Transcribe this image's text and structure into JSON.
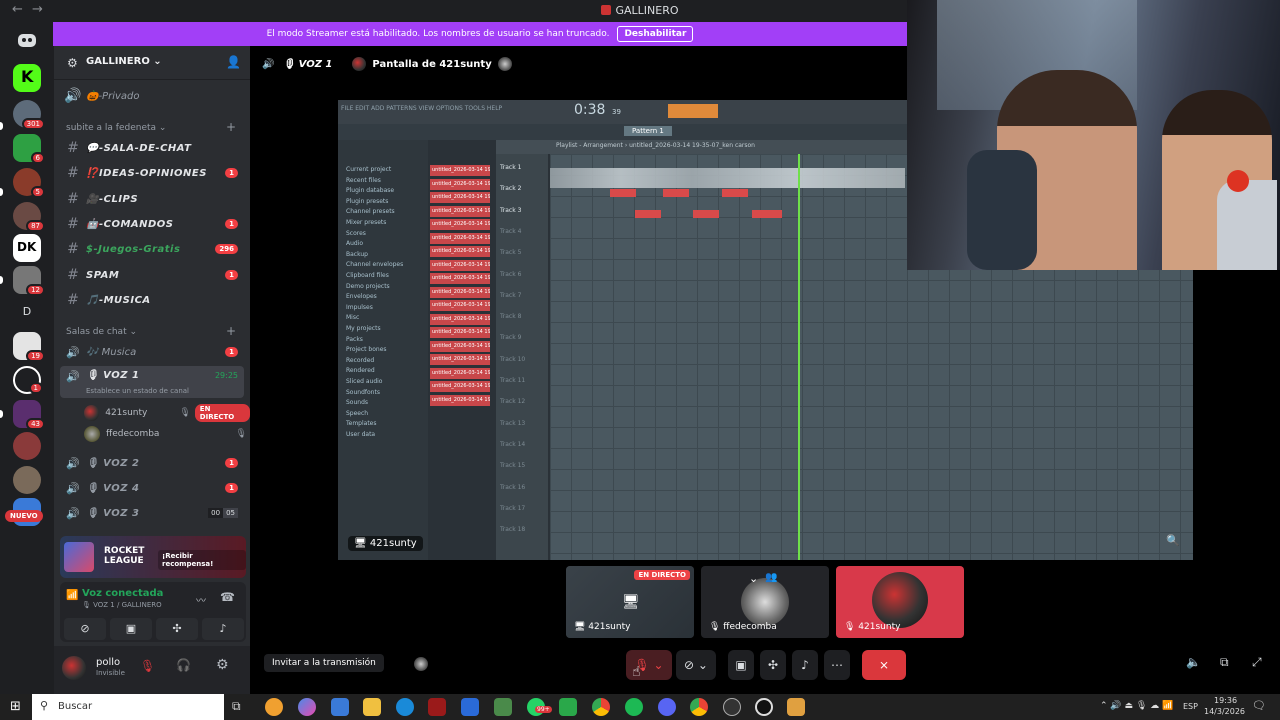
{
  "window": {
    "title": "GALLINERO",
    "back": "←",
    "forward": "→"
  },
  "guild_rail": {
    "badges": [
      "301",
      "6",
      "5",
      "87",
      "12",
      "D",
      "19",
      "1",
      "43"
    ],
    "new_label": "NUEVO"
  },
  "server": {
    "name": "GALLINERO ⌄",
    "private_channel": "🎃-Privado",
    "category1": "subite a la fedeneta",
    "text_channels": [
      {
        "name": "💬-SALA-DE-CHAT",
        "badge": ""
      },
      {
        "name": "⁉️IDEAS-OPINIONES",
        "badge": "1"
      },
      {
        "name": "🎥-CLIPS",
        "badge": ""
      },
      {
        "name": "🤖-COMANDOS",
        "badge": "1"
      },
      {
        "name": "$-Juegos-Gratis",
        "badge": "296"
      },
      {
        "name": "SPAM",
        "badge": "1"
      },
      {
        "name": "🎵-MUSICA",
        "badge": ""
      }
    ],
    "category2": "Salas de chat",
    "voice_channels": {
      "musica": {
        "name": "🎶 Musica",
        "badge": "1"
      },
      "voz1": {
        "name": "🎙 VOZ 1",
        "time": "29:25",
        "status": "Establece un estado de canal"
      },
      "voz1_users": [
        {
          "name": "421sunty",
          "live": "EN DIRECTO"
        },
        {
          "name": "ffedecomba"
        }
      ],
      "voz2": {
        "name": "🎙 VOZ 2",
        "badge": "1"
      },
      "voz4": {
        "name": "🎙 VOZ 4",
        "badge": "1"
      },
      "voz3": {
        "name": "🎙 VOZ 3",
        "count1": "00",
        "count2": "05"
      }
    }
  },
  "promo": {
    "game": "ROCKET LEAGUE",
    "cta": "¡Recibir recompensa!"
  },
  "voice_status": {
    "title": "Voz conectada",
    "subtitle": "🎙 VOZ 1 / GALLINERO"
  },
  "user": {
    "name": "pollo",
    "status": "Invisible"
  },
  "banner": {
    "text": "El modo Streamer está habilitado. Los nombres de usuario se han truncado.",
    "button": "Deshabilitar"
  },
  "voice_header": {
    "channel": "🎙 VOZ 1",
    "screen": "Pantalla de 421sunty"
  },
  "stage": {
    "streamer_label": "421sunty",
    "fl": {
      "menu": "FILE EDIT ADD PATTERNS VIEW OPTIONS TOOLS HELP",
      "time": "0:38",
      "time_sub": "39",
      "pattern": "Pattern 1",
      "playlist_title": "Playlist - Arrangement › untitled_2026-03-14 19-35-07_ken carson",
      "browser_items": [
        "Current project",
        "Recent files",
        "Plugin database",
        "Plugin presets",
        "Channel presets",
        "Mixer presets",
        "Scores",
        "Audio",
        "Backup",
        "Channel envelopes",
        "Clipboard files",
        "Demo projects",
        "Envelopes",
        "Impulses",
        "Misc",
        "My projects",
        "Packs",
        "Project bones",
        "Recorded",
        "Rendered",
        "Sliced audio",
        "Soundfonts",
        "Sounds",
        "Speech",
        "Templates",
        "User data"
      ],
      "clip_label": "untitled_2026-03-14 19..",
      "track_labels": [
        "Track 1",
        "Track 2",
        "Track 3",
        "Track 4",
        "Track 5",
        "Track 6",
        "Track 7",
        "Track 8",
        "Track 9",
        "Track 10",
        "Track 11",
        "Track 12",
        "Track 13",
        "Track 14",
        "Track 15",
        "Track 16",
        "Track 17",
        "Track 18"
      ]
    }
  },
  "tiles": [
    {
      "name": "421sunty",
      "live": "EN DIRECTO"
    },
    {
      "name": "ffedecomba"
    },
    {
      "name": "421sunty"
    }
  ],
  "controls": {
    "invite": "Invitar a la transmisión"
  },
  "taskbar": {
    "search": "Buscar",
    "lang": "ESP",
    "time": "19:36",
    "date": "14/3/2026",
    "notif": "1",
    "badge99": "99+"
  },
  "colors": {
    "brand": "#5865f2",
    "live": "#ed4245",
    "streamer": "#a23ff7",
    "online": "#23a55a"
  }
}
